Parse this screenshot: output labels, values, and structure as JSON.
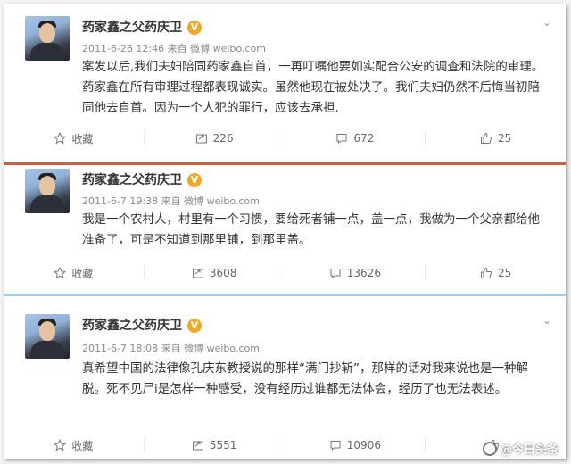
{
  "posts": [
    {
      "author": "药家鑫之父药庆卫",
      "verified_badge": "V",
      "meta": "2011-6-26 12:46 来自 微博 weibo.com",
      "text": "案发以后,我们夫妇陪同药家鑫自首，一再叮嘱他要如实配合公安的调查和法院的审理。药家鑫在所有审理过程都表现诚实。虽然他现在被处决了。我们夫妇仍然不后悔当初陪同他去自首。因为一个人犯的罪行，应该去承担.",
      "favorite_label": "收藏",
      "repost_count": "226",
      "comment_count": "672",
      "like_count": "25"
    },
    {
      "author": "药家鑫之父药庆卫",
      "verified_badge": "V",
      "meta": "2011-6-7 19:38 来自 微博 weibo.com",
      "text": "我是一个农村人，村里有一个习惯，要给死者铺一点，盖一点，我做为一个父亲都给他准备了，可是不知道到那里铺，到那里盖。",
      "favorite_label": "收藏",
      "repost_count": "3608",
      "comment_count": "13626",
      "like_count": "25"
    },
    {
      "author": "药家鑫之父药庆卫",
      "verified_badge": "V",
      "meta": "2011-6-7 18:08 来自 微博 weibo.com",
      "text": "真希望中国的法律像孔庆东教授说的那样“满门抄斩”，那样的话对我来说也是一种解脱。死不见尸i是怎样一种感受，没有经历过谁都无法体会，经历了也无法表述。",
      "favorite_label": "收藏",
      "repost_count": "5551",
      "comment_count": "10906",
      "like_count": ""
    }
  ],
  "watermark": "@今日头条",
  "colors": {
    "red_separator": "#d85c3a",
    "blue_separator": "#9fcbec",
    "verified": "#f5a623"
  }
}
